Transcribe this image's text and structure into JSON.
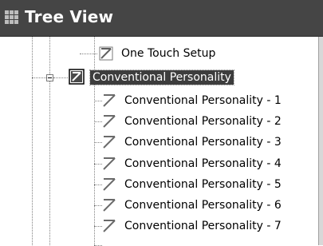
{
  "window": {
    "title": "Tree View",
    "title_icon": "grid-icon"
  },
  "tree": {
    "top_item": {
      "label": "One Touch Setup",
      "icon": "personality-icon"
    },
    "parent": {
      "label": "Conventional Personality",
      "icon": "personality-folder-icon",
      "expanded": true,
      "selected": true
    },
    "children": [
      {
        "label": "Conventional Personality - 1",
        "icon": "personality-icon"
      },
      {
        "label": "Conventional Personality - 2",
        "icon": "personality-icon"
      },
      {
        "label": "Conventional Personality - 3",
        "icon": "personality-icon"
      },
      {
        "label": "Conventional Personality - 4",
        "icon": "personality-icon"
      },
      {
        "label": "Conventional Personality - 5",
        "icon": "personality-icon"
      },
      {
        "label": "Conventional Personality - 6",
        "icon": "personality-icon"
      },
      {
        "label": "Conventional Personality - 7",
        "icon": "personality-icon"
      }
    ]
  },
  "colors": {
    "title_bar": "#454545",
    "selection": "#3d3d3d",
    "tree_line": "#808080"
  }
}
